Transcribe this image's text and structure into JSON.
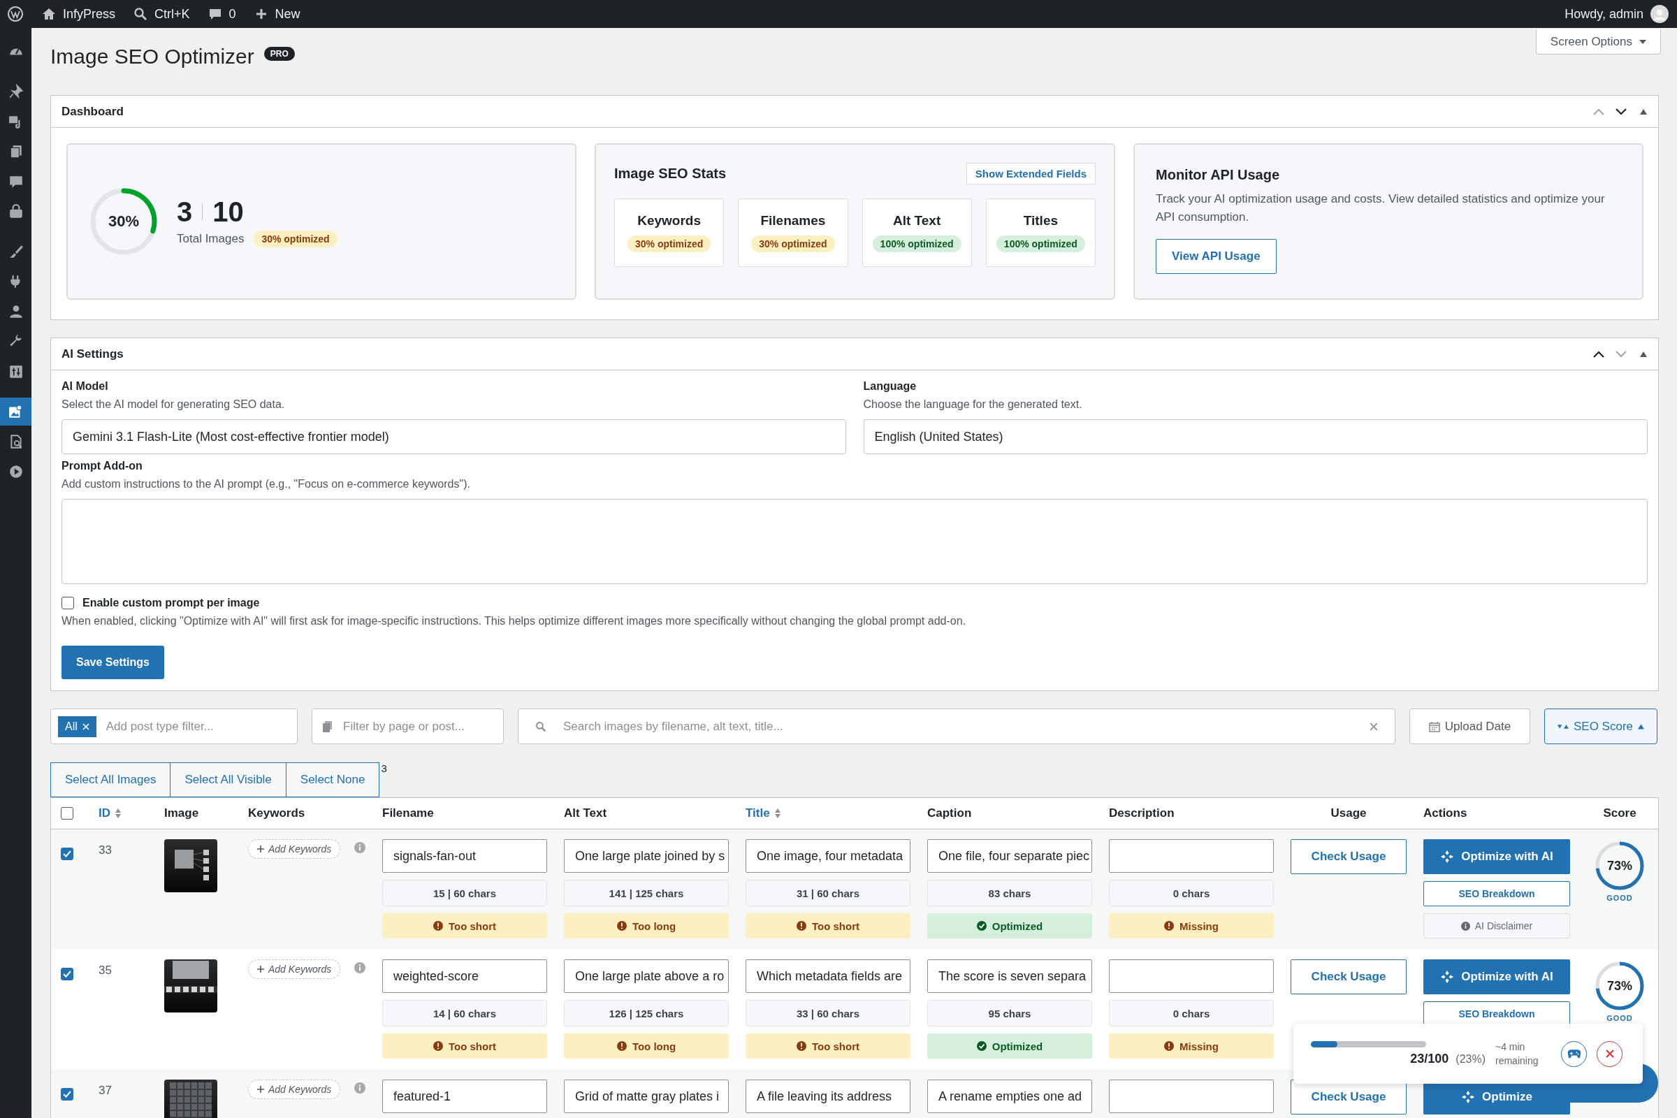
{
  "admin_bar": {
    "site": "InfyPress",
    "search": "Ctrl+K",
    "comments": "0",
    "new": "New",
    "greeting": "Howdy, admin"
  },
  "sidebar": {
    "items": [
      {
        "selected": false
      },
      {
        "selected": false
      },
      {
        "selected": false
      },
      {
        "selected": false
      },
      {
        "selected": false
      },
      {
        "selected": false
      },
      {
        "selected": false
      },
      {
        "selected": false
      },
      {
        "selected": false
      },
      {
        "selected": false
      },
      {
        "selected": false
      },
      {
        "selected": true
      },
      {
        "selected": false
      },
      {
        "selected": false
      }
    ]
  },
  "screen_options": "Screen Options",
  "page": {
    "title": "Image SEO Optimizer",
    "badge": "PRO"
  },
  "dashboard": {
    "title": "Dashboard",
    "move_up_disabled": true,
    "move_down_disabled": false,
    "summary": {
      "percent": "30%",
      "level": 0.3,
      "optimized_count": "3",
      "total_count": "10",
      "label": "Total Images",
      "badge": "30% optimized"
    },
    "stats": {
      "title": "Image SEO Stats",
      "toggle": "Show Extended Fields",
      "items": [
        {
          "label": "Keywords",
          "badge": "30% optimized",
          "kind": "partial"
        },
        {
          "label": "Filenames",
          "badge": "30% optimized",
          "kind": "partial"
        },
        {
          "label": "Alt Text",
          "badge": "100% optimized",
          "kind": "complete"
        },
        {
          "label": "Titles",
          "badge": "100% optimized",
          "kind": "complete"
        }
      ]
    },
    "api": {
      "title": "Monitor API Usage",
      "text": "Track your AI optimization usage and costs. View detailed statistics and optimize your API consumption.",
      "button": "View API Usage"
    }
  },
  "ai_settings": {
    "title": "AI Settings",
    "move_up_disabled": false,
    "move_down_disabled": true,
    "model": {
      "label": "AI Model",
      "help": "Select the AI model for generating SEO data.",
      "value": "Gemini 3.1 Flash-Lite (Most cost-effective frontier model)"
    },
    "language": {
      "label": "Language",
      "help": "Choose the language for the generated text.",
      "value": "English (United States)"
    },
    "prompt": {
      "label": "Prompt Add-on",
      "help": "Add custom instructions to the AI prompt (e.g., \"Focus on e-commerce keywords\")."
    },
    "custom_prompt": {
      "label": "Enable custom prompt per image",
      "checked": false,
      "help": "When enabled, clicking \"Optimize with AI\" will first ask for image-specific instructions. This helps optimize different images more specifically without changing the global prompt add-on."
    },
    "save": "Save Settings"
  },
  "filters": {
    "chip": "All",
    "post_type_placeholder": "Add post type filter...",
    "page_placeholder": "Filter by page or post...",
    "search_placeholder": "Search images by filename, alt text, title...",
    "sorts": [
      {
        "label": "Upload Date",
        "kind": "date",
        "selected": false
      },
      {
        "label": "SEO Score",
        "kind": "score",
        "selected": true
      }
    ]
  },
  "selection": {
    "buttons": [
      "Select All Images",
      "Select All Visible",
      "Select None"
    ],
    "count": "3"
  },
  "table": {
    "all_checked": false,
    "columns": [
      {
        "label": "ID",
        "sortable": true
      },
      {
        "label": "Image",
        "sortable": false
      },
      {
        "label": "Keywords",
        "sortable": false
      },
      {
        "label": "Filename",
        "sortable": false
      },
      {
        "label": "Alt Text",
        "sortable": false
      },
      {
        "label": "Title",
        "sortable": true
      },
      {
        "label": "Caption",
        "sortable": false
      },
      {
        "label": "Description",
        "sortable": false
      },
      {
        "label": "Usage",
        "sortable": false
      },
      {
        "label": "Actions",
        "sortable": false
      },
      {
        "label": "Score",
        "sortable": false
      }
    ],
    "rows": [
      {
        "checked": true,
        "id": "33",
        "image": {
          "kind": "picture"
        },
        "keywords": "Add Keywords",
        "fields": [
          {
            "value": "signals-fan-out",
            "chars": "15 | 60 chars",
            "status": {
              "text": "Too short",
              "kind": "warning"
            }
          },
          {
            "value": "One large plate joined by s",
            "chars": "141 | 125 chars",
            "status": {
              "text": "Too long",
              "kind": "warning"
            }
          },
          {
            "value": "One image, four metadata",
            "chars": "31 | 60 chars",
            "status": {
              "text": "Too short",
              "kind": "warning"
            }
          },
          {
            "value": "One file, four separate piec",
            "chars": "83 chars",
            "status": {
              "text": "Optimized",
              "kind": "ok"
            }
          },
          {
            "chars": "0 chars",
            "status": {
              "text": "Missing",
              "kind": "warning"
            }
          }
        ],
        "usage": "Check Usage",
        "optimize": "Optimize with AI",
        "breakdown": "SEO Breakdown",
        "disclaimer": "AI Disclaimer",
        "score": {
          "value": "73%",
          "level": 0.73,
          "grade": "GOOD"
        }
      },
      {
        "checked": true,
        "id": "35",
        "image": {
          "kind": "picture"
        },
        "keywords": "Add Keywords",
        "fields": [
          {
            "value": "weighted-score",
            "chars": "14 | 60 chars",
            "status": {
              "text": "Too short",
              "kind": "warning"
            }
          },
          {
            "value": "One large plate above a ro",
            "chars": "126 | 125 chars",
            "status": {
              "text": "Too long",
              "kind": "warning"
            }
          },
          {
            "value": "Which metadata fields are",
            "chars": "33 | 60 chars",
            "status": {
              "text": "Too short",
              "kind": "warning"
            }
          },
          {
            "value": "The score is seven separa",
            "chars": "95 chars",
            "status": {
              "text": "Optimized",
              "kind": "ok"
            }
          },
          {
            "chars": "0 chars",
            "status": {
              "text": "Missing",
              "kind": "warning"
            }
          }
        ],
        "usage": "Check Usage",
        "optimize": "Optimize with AI",
        "breakdown": "SEO Breakdown",
        "score": {
          "value": "73%",
          "level": 0.73,
          "grade": "GOOD"
        }
      },
      {
        "checked": true,
        "id": "37",
        "image": {
          "kind": "picture"
        },
        "keywords": "Add Keywords",
        "fields": [
          {
            "value": "featured-1"
          },
          {
            "value": "Grid of matte gray plates i"
          },
          {
            "value": "A file leaving its address"
          },
          {
            "value": "A rename empties one ad"
          }
        ],
        "usage": "Check Usage",
        "optimize": "Optimize"
      }
    ]
  },
  "progress": {
    "level": 0.23,
    "count": "23/100",
    "percent": "(23%)",
    "remaining": "~4 min remaining"
  }
}
